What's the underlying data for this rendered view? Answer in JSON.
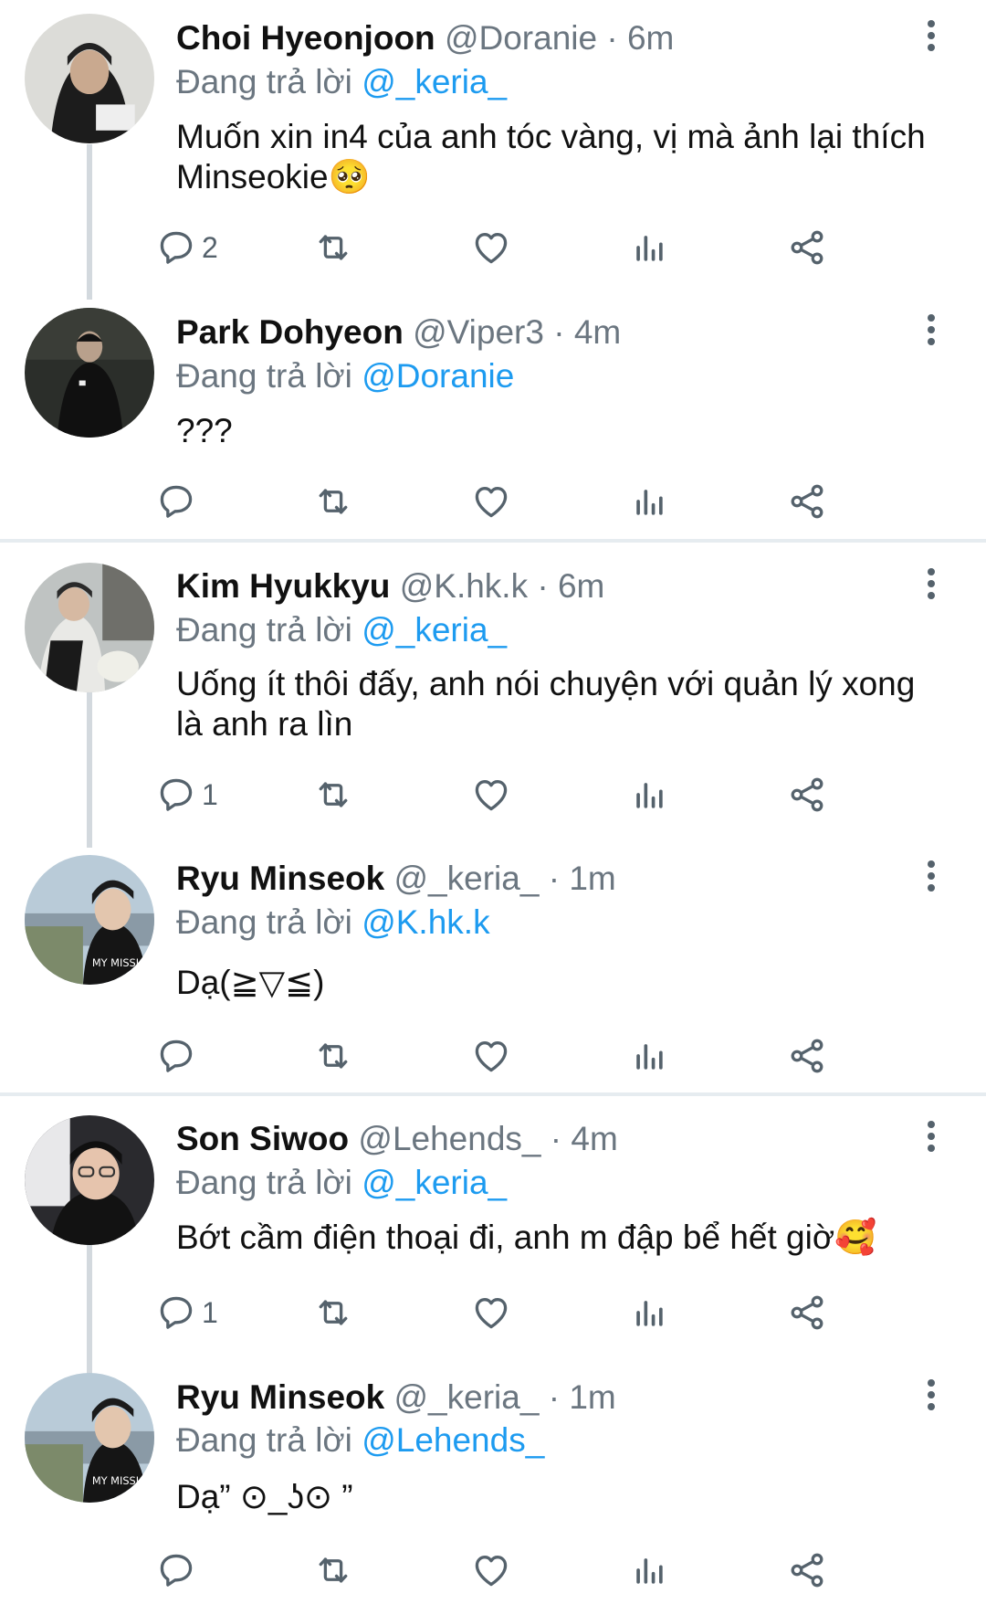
{
  "tweets": [
    {
      "name": "Choi Hyeonjoon",
      "handle": "@Doranie",
      "dot": "·",
      "time": "6m",
      "replying_prefix": "Đang trả lời",
      "replying_to": "@_keria_",
      "text": "Muốn xin in4 của anh tóc vàng, vị mà ảnh lại thích Minseokie🥺",
      "replies": "2"
    },
    {
      "name": "Park Dohyeon",
      "handle": "@Viper3",
      "dot": "·",
      "time": "4m",
      "replying_prefix": "Đang trả lời",
      "replying_to": "@Doranie",
      "text": "???",
      "replies": ""
    },
    {
      "name": "Kim Hyukkyu",
      "handle": "@K.hk.k",
      "dot": "·",
      "time": "6m",
      "replying_prefix": "Đang trả lời",
      "replying_to": "@_keria_",
      "text": "Uống ít thôi đấy, anh nói chuyện với quản lý xong là anh ra lìn",
      "replies": "1"
    },
    {
      "name": "Ryu Minseok",
      "handle": "@_keria_",
      "dot": "·",
      "time": "1m",
      "replying_prefix": "Đang trả lời",
      "replying_to": "@K.hk.k",
      "text": "Dạ(≧▽≦)",
      "replies": ""
    },
    {
      "name": "Son Siwoo",
      "handle": "@Lehends_",
      "dot": "·",
      "time": "4m",
      "replying_prefix": "Đang trả lời",
      "replying_to": "@_keria_",
      "text": "Bớt cầm điện thoại đi, anh m đập bể hết giờ🥰",
      "replies": "1"
    },
    {
      "name": "Ryu Minseok",
      "handle": "@_keria_",
      "dot": "·",
      "time": "1m",
      "replying_prefix": "Đang trả lời",
      "replying_to": "@Lehends_",
      "text": "Dạ” ⊙_ʖ⊙ ”",
      "replies": ""
    }
  ],
  "icons": {
    "reply": "reply-icon",
    "retweet": "retweet-icon",
    "like": "like-icon",
    "views": "views-icon",
    "share": "share-icon",
    "more": "more-vertical-icon"
  },
  "colors": {
    "mention": "#1d9bf0",
    "muted": "#6b7680",
    "thread_line": "#d3d9de"
  }
}
